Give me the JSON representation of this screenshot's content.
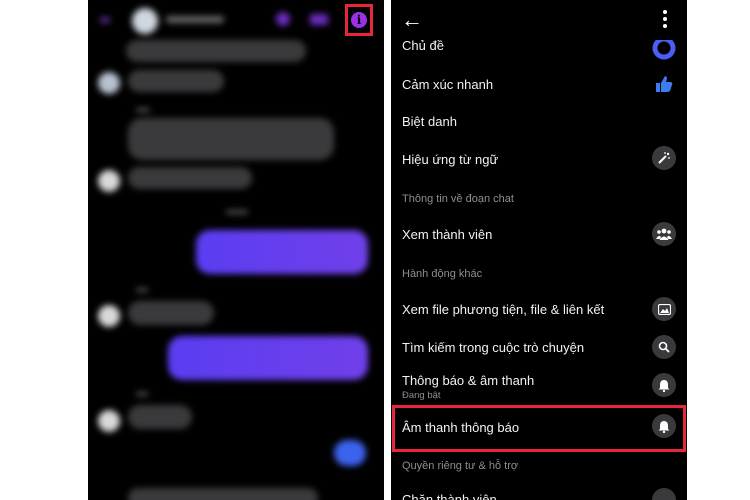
{
  "left_screen": {
    "info_button": "info-icon"
  },
  "settings": {
    "items": {
      "chu_de": "Chủ đề",
      "cam_xuc": "Cảm xúc nhanh",
      "biet_danh": "Biệt danh",
      "hieu_ung": "Hiệu ứng từ ngữ",
      "xem_thanh_vien": "Xem thành viên",
      "xem_file": "Xem file phương tiện, file & liên kết",
      "tim_kiem": "Tìm kiếm trong cuộc trò chuyện",
      "thong_bao": "Thông báo & âm thanh",
      "thong_bao_status": "Đang bật",
      "am_thanh": "Âm thanh thông báo",
      "chan": "Chặn thành viên"
    },
    "sections": {
      "thong_tin": "Thông tin về đoạn chat",
      "hanh_dong": "Hành động khác",
      "quyen_rieng_tu": "Quyền riêng tư & hỗ trợ"
    }
  },
  "colors": {
    "highlight": "#e8263a",
    "accent": "#9b30e6",
    "like_blue": "#3c7bf0"
  }
}
